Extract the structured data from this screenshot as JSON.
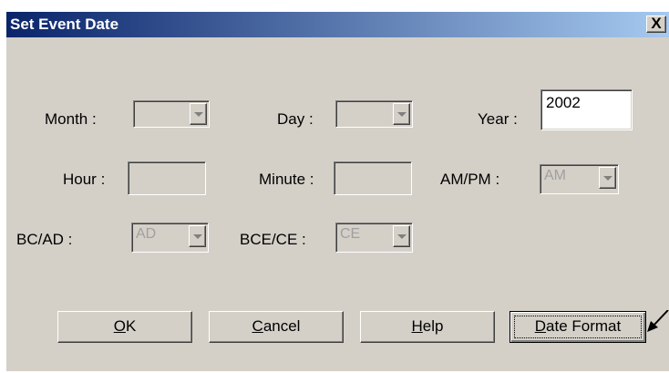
{
  "dialog": {
    "title": "Set Event Date",
    "close_label": "X"
  },
  "fields": {
    "month": {
      "label": "Month :",
      "value": ""
    },
    "day": {
      "label": "Day :",
      "value": ""
    },
    "year": {
      "label": "Year :",
      "value": "2002"
    },
    "hour": {
      "label": "Hour :",
      "value": ""
    },
    "minute": {
      "label": "Minute :",
      "value": ""
    },
    "ampm": {
      "label": "AM/PM :",
      "value": "AM"
    },
    "bcad": {
      "label": "BC/AD :",
      "value": "AD"
    },
    "bcece": {
      "label": "BCE/CE :",
      "value": "CE"
    }
  },
  "buttons": {
    "ok": {
      "mnemonic": "O",
      "rest": "K"
    },
    "cancel": {
      "mnemonic": "C",
      "rest": "ancel"
    },
    "help": {
      "mnemonic": "H",
      "rest": "elp"
    },
    "date_format": {
      "mnemonic": "D",
      "rest": "ate Format"
    }
  },
  "colors": {
    "title_gradient_start": "#0a246a",
    "title_gradient_end": "#a6caf0",
    "face": "#d4d0c8"
  }
}
